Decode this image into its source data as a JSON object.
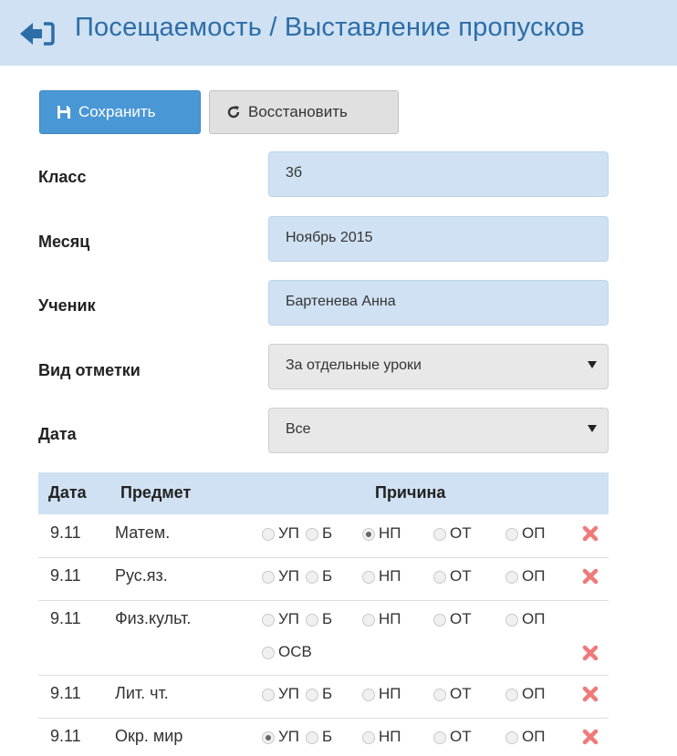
{
  "header": {
    "title": "Посещаемость / Выставление пропусков"
  },
  "toolbar": {
    "save_label": "Сохранить",
    "restore_label": "Восстановить"
  },
  "form": {
    "class": {
      "label": "Класс",
      "value": "3б"
    },
    "month": {
      "label": "Месяц",
      "value": "Ноябрь 2015"
    },
    "student": {
      "label": "Ученик",
      "value": "Бартенева Анна"
    },
    "mark_type": {
      "label": "Вид отметки",
      "value": "За отдельные уроки"
    },
    "date": {
      "label": "Дата",
      "value": "Все"
    }
  },
  "table": {
    "headers": [
      "Дата",
      "Предмет",
      "Причина"
    ],
    "rows": [
      {
        "date": "9.11",
        "subject": "Матем.",
        "selected": "НП"
      },
      {
        "date": "9.11",
        "subject": "Рус.яз.",
        "selected": ""
      },
      {
        "date": "9.11",
        "subject": "Физ.культ.",
        "selected": "",
        "extra": "ОСВ"
      },
      {
        "date": "9.11",
        "subject": "Лит. чт.",
        "selected": ""
      },
      {
        "date": "9.11",
        "subject": "Окр. мир",
        "selected": "УП"
      }
    ],
    "reasons": [
      "УП",
      "Б",
      "НП",
      "ОТ",
      "ОП"
    ]
  },
  "colors": {
    "accent": "#2d6da8",
    "header_bg": "#cfe1f2",
    "delete": "#f07a7a"
  },
  "icons": {
    "back": "back-arrow-icon",
    "save": "save-icon",
    "restore": "refresh-icon",
    "delete": "delete-x-icon"
  }
}
